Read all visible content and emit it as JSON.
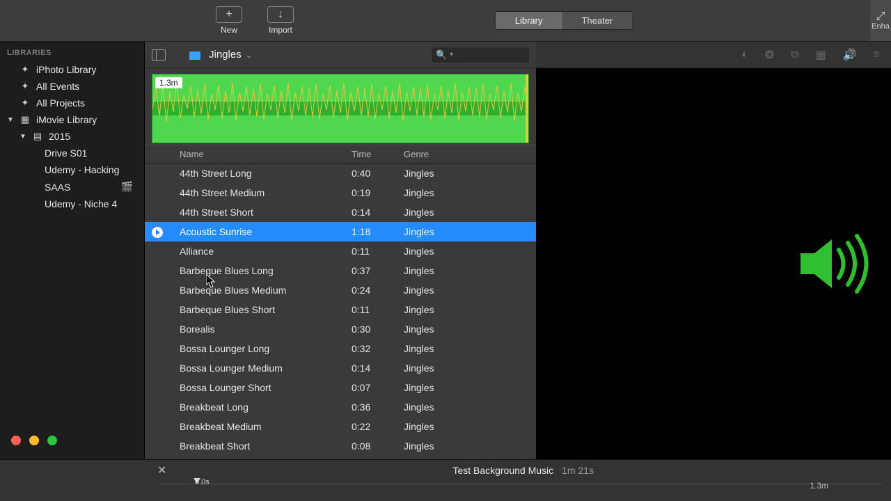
{
  "toolbar": {
    "new_label": "New",
    "import_label": "Import",
    "tabs": [
      "Library",
      "Theater"
    ],
    "active_tab": 0,
    "enhance_label": "Enha"
  },
  "sidebar": {
    "header": "LIBRARIES",
    "items": [
      {
        "label": "iPhoto Library",
        "icon": "photo",
        "level": 1
      },
      {
        "label": "All Events",
        "icon": "star",
        "level": 1
      },
      {
        "label": "All Projects",
        "icon": "star",
        "level": 1
      },
      {
        "label": "iMovie Library",
        "icon": "grid",
        "level": 1,
        "disclose": "down"
      },
      {
        "label": "2015",
        "icon": "cal",
        "level": 2,
        "disclose": "down"
      },
      {
        "label": "Drive S01",
        "icon": "",
        "level": 4
      },
      {
        "label": "Udemy - Hacking",
        "icon": "",
        "level": 4
      },
      {
        "label": "SAAS",
        "icon": "",
        "level": 4,
        "clap": true
      },
      {
        "label": "Udemy - Niche 4",
        "icon": "",
        "level": 4
      }
    ]
  },
  "breadcrumb": {
    "title": "Jingles"
  },
  "waveform": {
    "tag": "1.3m"
  },
  "table": {
    "columns": [
      "Name",
      "Time",
      "Genre"
    ],
    "selected_index": 3,
    "rows": [
      {
        "name": "44th Street Long",
        "time": "0:40",
        "genre": "Jingles"
      },
      {
        "name": "44th Street Medium",
        "time": "0:19",
        "genre": "Jingles"
      },
      {
        "name": "44th Street Short",
        "time": "0:14",
        "genre": "Jingles"
      },
      {
        "name": "Acoustic Sunrise",
        "time": "1:18",
        "genre": "Jingles"
      },
      {
        "name": "Alliance",
        "time": "0:11",
        "genre": "Jingles"
      },
      {
        "name": "Barbeque Blues Long",
        "time": "0:37",
        "genre": "Jingles"
      },
      {
        "name": "Barbeque Blues Medium",
        "time": "0:24",
        "genre": "Jingles"
      },
      {
        "name": "Barbeque Blues Short",
        "time": "0:11",
        "genre": "Jingles"
      },
      {
        "name": "Borealis",
        "time": "0:30",
        "genre": "Jingles"
      },
      {
        "name": "Bossa Lounger Long",
        "time": "0:32",
        "genre": "Jingles"
      },
      {
        "name": "Bossa Lounger Medium",
        "time": "0:14",
        "genre": "Jingles"
      },
      {
        "name": "Bossa Lounger Short",
        "time": "0:07",
        "genre": "Jingles"
      },
      {
        "name": "Breakbeat Long",
        "time": "0:36",
        "genre": "Jingles"
      },
      {
        "name": "Breakbeat Medium",
        "time": "0:22",
        "genre": "Jingles"
      },
      {
        "name": "Breakbeat Short",
        "time": "0:08",
        "genre": "Jingles"
      }
    ]
  },
  "project": {
    "title": "Test Background Music",
    "duration": "1m 21s",
    "ruler_start": "0.0s",
    "ruler_end": "1.3m"
  }
}
